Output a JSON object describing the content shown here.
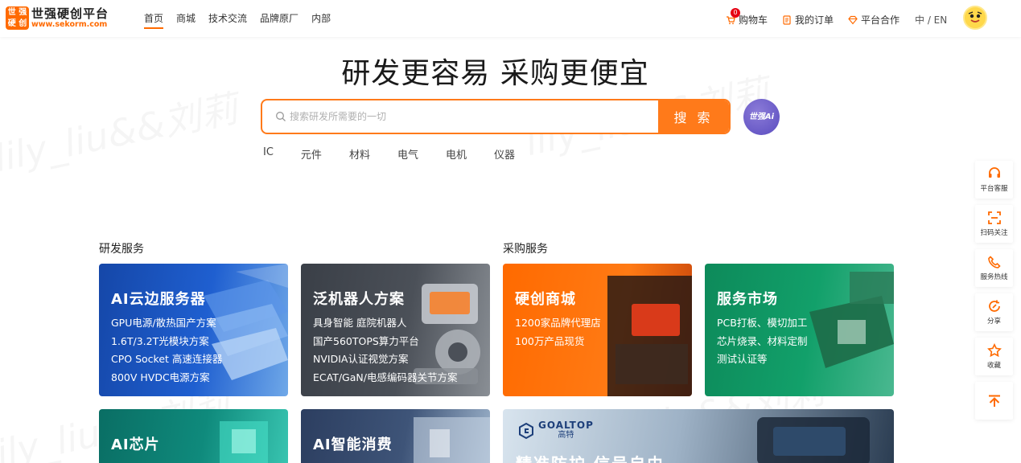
{
  "header": {
    "logo": {
      "mark": [
        "世",
        "强",
        "硬",
        "创"
      ],
      "name": "世强硬创平台",
      "url": "www.sekorm.com"
    },
    "nav": [
      "首页",
      "商城",
      "技术交流",
      "品牌原厂",
      "内部"
    ],
    "cart": {
      "label": "购物车",
      "count": "0"
    },
    "orders_label": "我的订单",
    "partner_label": "平台合作",
    "lang_label": "中 / EN"
  },
  "hero": {
    "slogan": "研发更容易 采购更便宜",
    "search_placeholder": "搜索研发所需要的一切",
    "search_button": "搜 索",
    "ai_label": "世强Ai",
    "categories": [
      "IC",
      "元件",
      "材料",
      "电气",
      "电机",
      "仪器"
    ]
  },
  "sections": {
    "rd_title": "研发服务",
    "purchase_title": "采购服务"
  },
  "cards": [
    {
      "title": "AI云边服务器",
      "lines": [
        "GPU电源/散热国产方案",
        "1.6T/3.2T光模块方案",
        "CPO Socket 高速连接器",
        "800V HVDC电源方案"
      ]
    },
    {
      "title": "泛机器人方案",
      "lines": [
        "具身智能 庭院机器人",
        "国产560TOPS算力平台",
        "NVIDIA认证视觉方案",
        "ECAT/GaN/电感编码器关节方案"
      ]
    },
    {
      "title": "硬创商城",
      "lines": [
        "1200家品牌代理店",
        "100万产品现货"
      ]
    },
    {
      "title": "服务市场",
      "lines": [
        "PCB打板、模切加工",
        "芯片烧录、材料定制",
        "测试认证等"
      ]
    },
    {
      "title": "AI芯片",
      "lines": []
    },
    {
      "title": "AI智能消费",
      "lines": []
    }
  ],
  "banner": {
    "brand_en": "GOALTOP",
    "brand_cn": "高特",
    "headline": "精准防护 信号自由"
  },
  "rail": [
    "平台客服",
    "扫码关注",
    "服务热线",
    "分享",
    "收藏"
  ],
  "watermark": "lily_liu&&刘莉",
  "colors": {
    "accent": "#ff6a00",
    "search_border": "#ff7a1a"
  }
}
